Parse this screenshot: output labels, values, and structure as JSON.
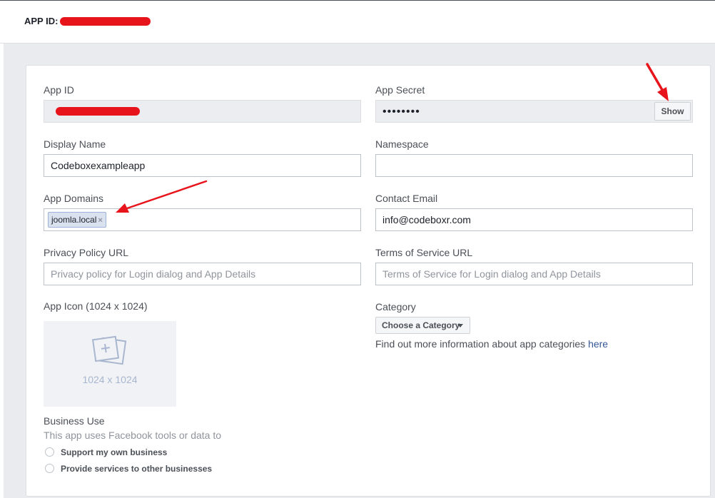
{
  "header": {
    "title": "APP ID:"
  },
  "fields": {
    "app_id": {
      "label": "App ID"
    },
    "app_secret": {
      "label": "App Secret",
      "value": "••••••••",
      "show_label": "Show"
    },
    "display_name": {
      "label": "Display Name",
      "value": "Codeboxexampleapp"
    },
    "namespace": {
      "label": "Namespace",
      "value": ""
    },
    "app_domains": {
      "label": "App Domains",
      "tags": [
        "joomla.local"
      ],
      "remove_glyph": "×"
    },
    "contact_email": {
      "label": "Contact Email",
      "value": "info@codeboxr.com"
    },
    "privacy_url": {
      "label": "Privacy Policy URL",
      "placeholder": "Privacy policy for Login dialog and App Details"
    },
    "terms_url": {
      "label": "Terms of Service URL",
      "placeholder": "Terms of Service for Login dialog and App Details"
    },
    "app_icon": {
      "label": "App Icon (1024 x 1024)",
      "dimensions": "1024 x 1024"
    },
    "category": {
      "label": "Category",
      "button_label": "Choose a Category",
      "info_text": "Find out more information about app categories",
      "info_link": "here"
    },
    "business_use": {
      "label": "Business Use",
      "description": "This app uses Facebook tools or data to",
      "options": [
        "Support my own business",
        "Provide services to other businesses"
      ]
    }
  },
  "colors": {
    "annotation_red": "#e8141b",
    "link_blue": "#365899",
    "page_bg": "#e9ebee"
  }
}
